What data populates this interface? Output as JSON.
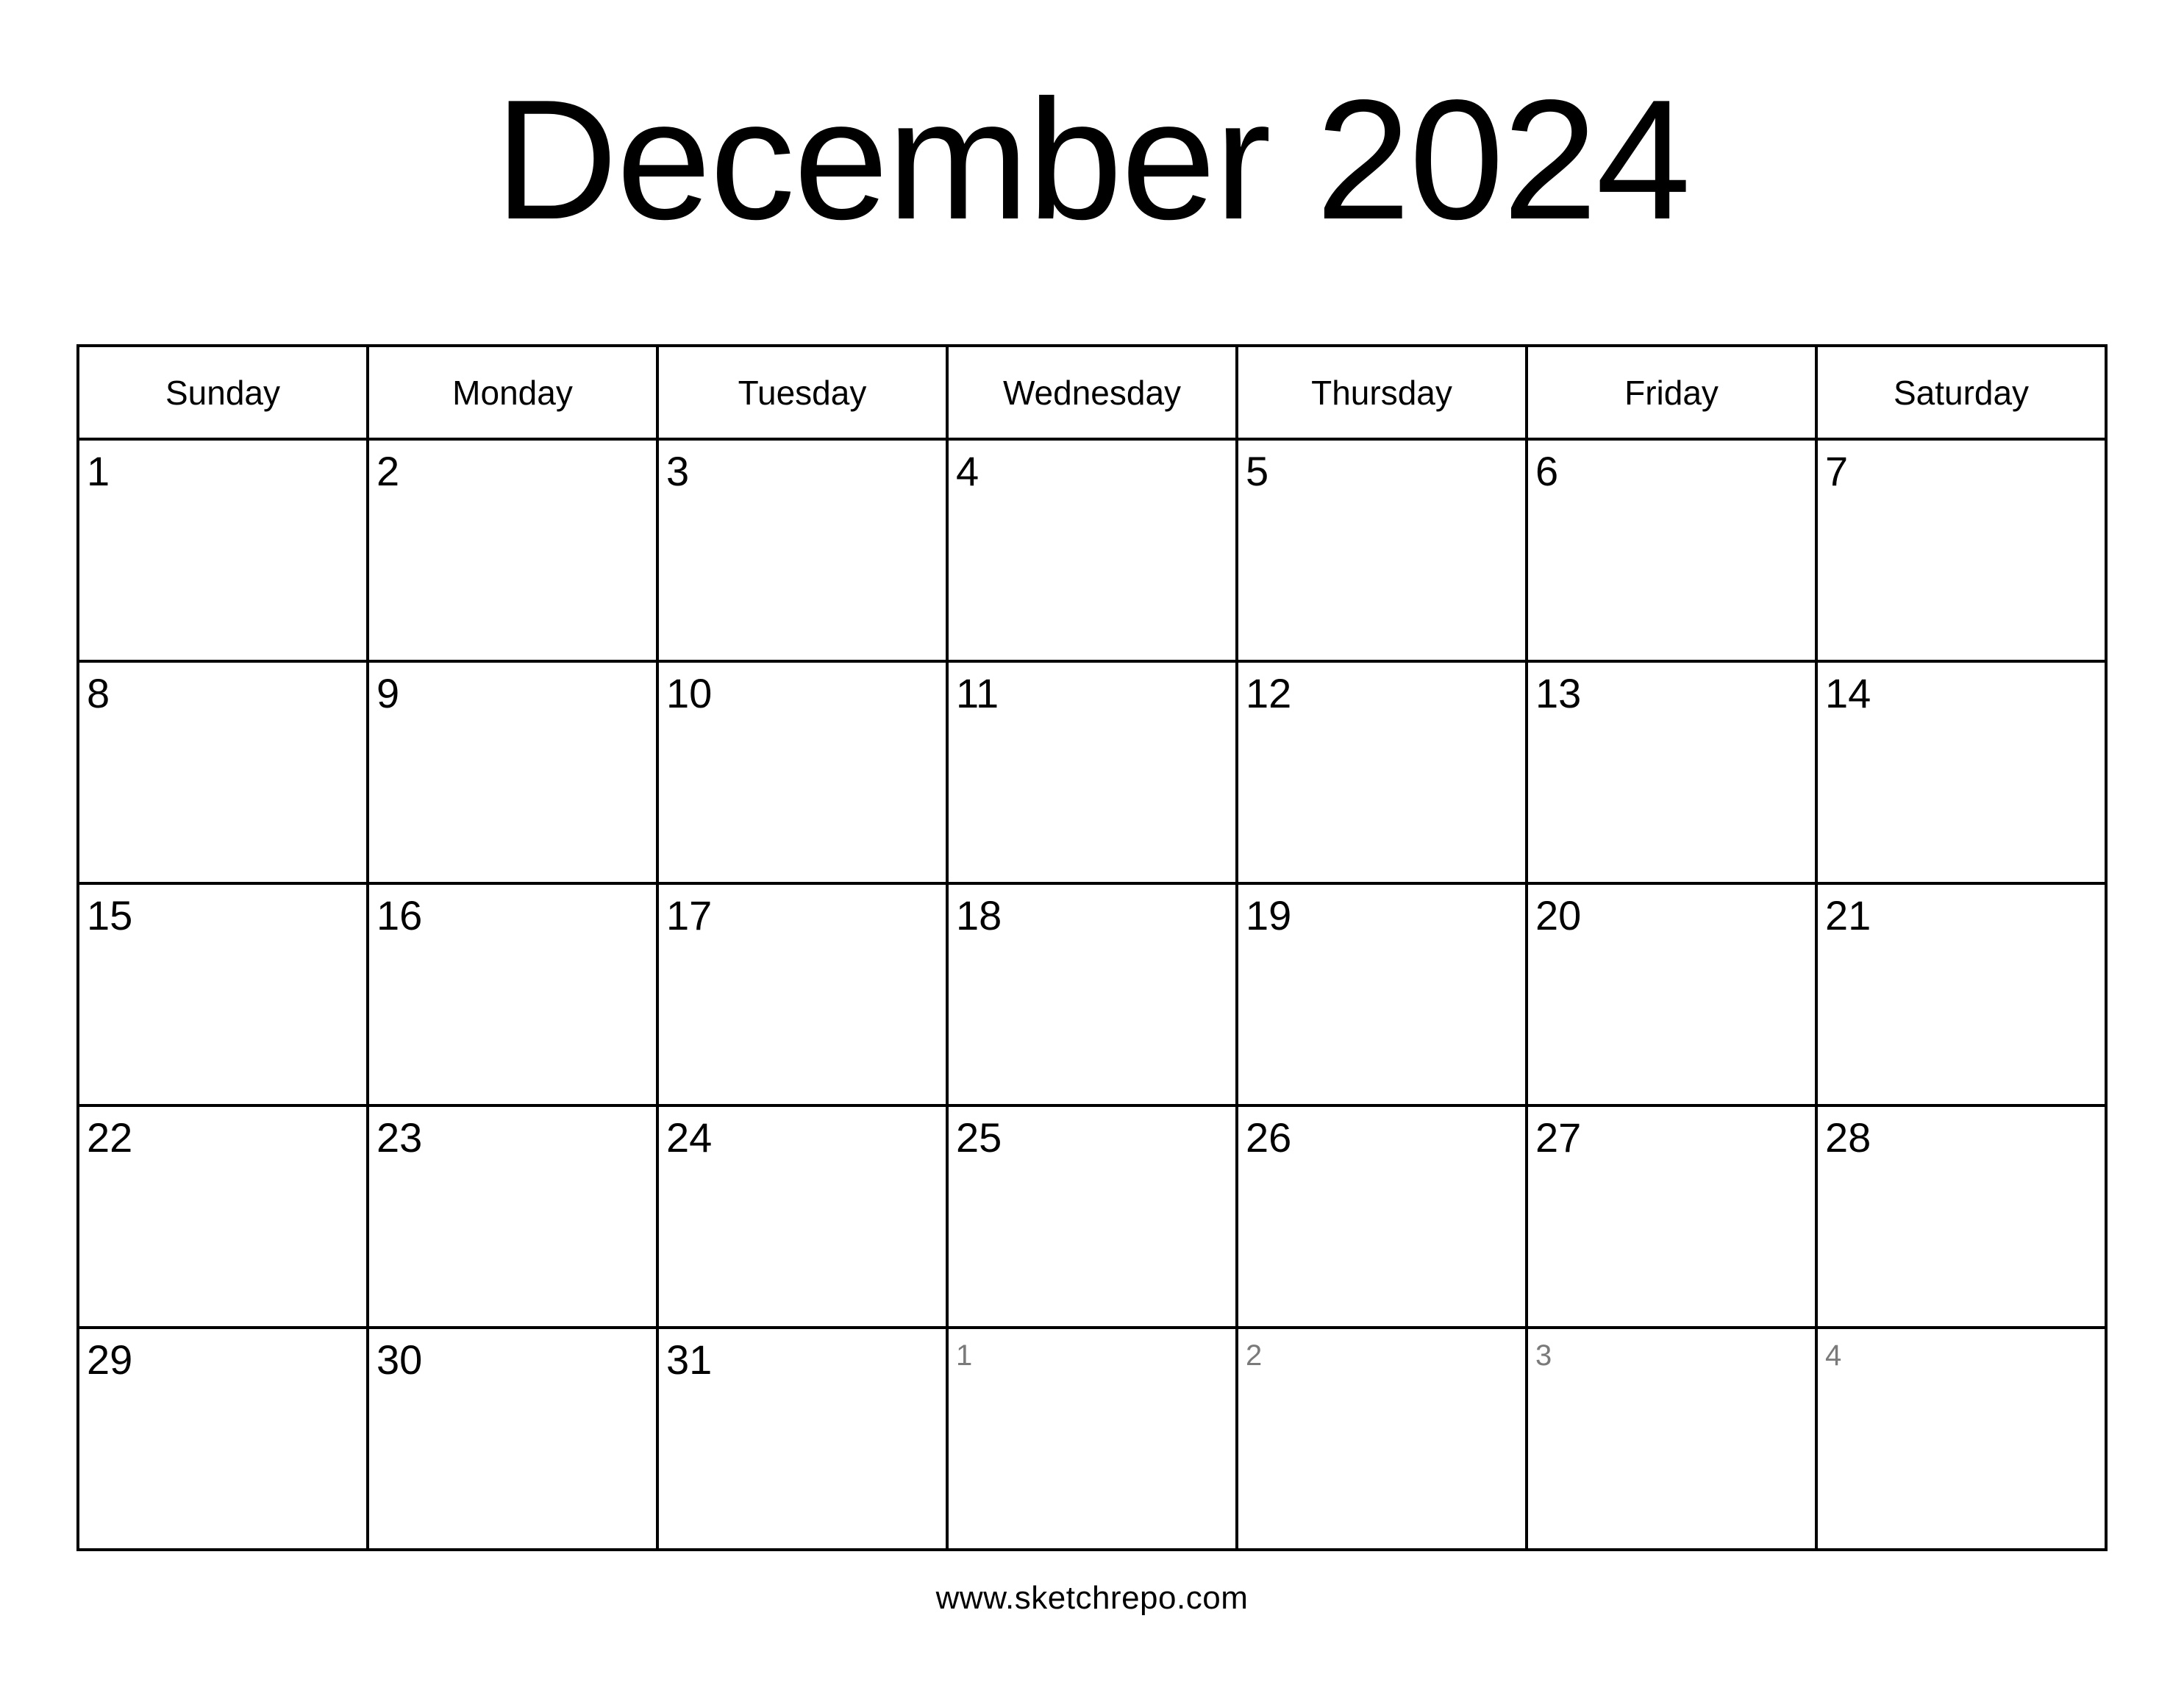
{
  "title": "December 2024",
  "month": "December",
  "year": "2024",
  "weekdays": [
    {
      "label": "Sunday"
    },
    {
      "label": "Monday"
    },
    {
      "label": "Tuesday"
    },
    {
      "label": "Wednesday"
    },
    {
      "label": "Thursday"
    },
    {
      "label": "Friday"
    },
    {
      "label": "Saturday"
    }
  ],
  "weeks": [
    [
      {
        "num": "1",
        "muted": false
      },
      {
        "num": "2",
        "muted": false
      },
      {
        "num": "3",
        "muted": false
      },
      {
        "num": "4",
        "muted": false
      },
      {
        "num": "5",
        "muted": false
      },
      {
        "num": "6",
        "muted": false
      },
      {
        "num": "7",
        "muted": false
      }
    ],
    [
      {
        "num": "8",
        "muted": false
      },
      {
        "num": "9",
        "muted": false
      },
      {
        "num": "10",
        "muted": false
      },
      {
        "num": "11",
        "muted": false
      },
      {
        "num": "12",
        "muted": false
      },
      {
        "num": "13",
        "muted": false
      },
      {
        "num": "14",
        "muted": false
      }
    ],
    [
      {
        "num": "15",
        "muted": false
      },
      {
        "num": "16",
        "muted": false
      },
      {
        "num": "17",
        "muted": false
      },
      {
        "num": "18",
        "muted": false
      },
      {
        "num": "19",
        "muted": false
      },
      {
        "num": "20",
        "muted": false
      },
      {
        "num": "21",
        "muted": false
      }
    ],
    [
      {
        "num": "22",
        "muted": false
      },
      {
        "num": "23",
        "muted": false
      },
      {
        "num": "24",
        "muted": false
      },
      {
        "num": "25",
        "muted": false
      },
      {
        "num": "26",
        "muted": false
      },
      {
        "num": "27",
        "muted": false
      },
      {
        "num": "28",
        "muted": false
      }
    ],
    [
      {
        "num": "29",
        "muted": false
      },
      {
        "num": "30",
        "muted": false
      },
      {
        "num": "31",
        "muted": false
      },
      {
        "num": "1",
        "muted": true
      },
      {
        "num": "2",
        "muted": true
      },
      {
        "num": "3",
        "muted": true
      },
      {
        "num": "4",
        "muted": true
      }
    ]
  ],
  "footer": {
    "text": "www.sketchrepo.com"
  },
  "colors": {
    "background": "#ffffff",
    "text": "#000000",
    "muted_text": "#7a7a7a",
    "grid_line": "#000000"
  }
}
